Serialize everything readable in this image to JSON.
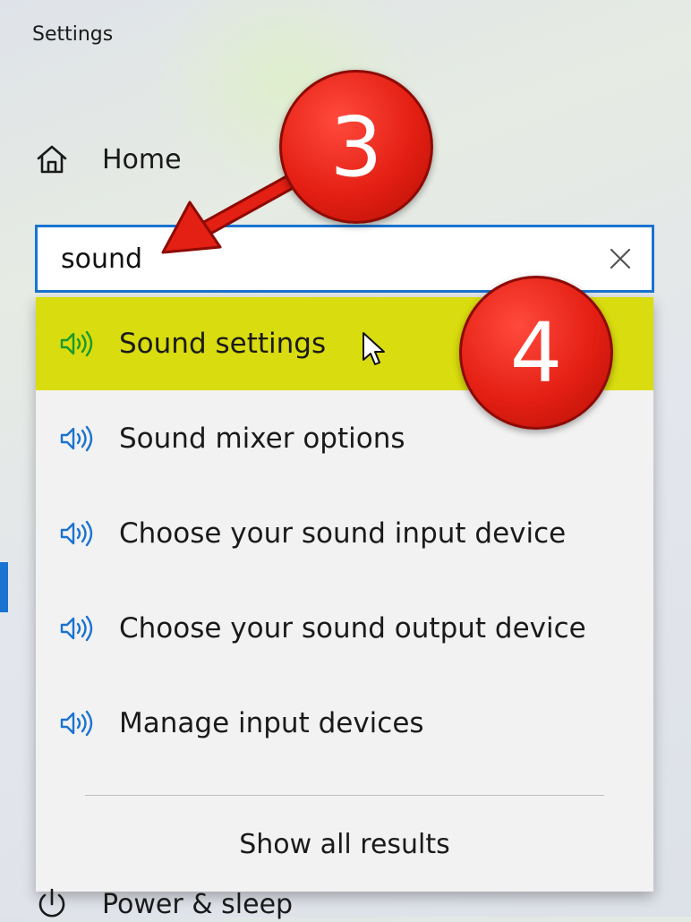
{
  "window": {
    "title": "Settings"
  },
  "sidebar": {
    "home_label": "Home",
    "bottom_item_label": "Power & sleep"
  },
  "search": {
    "value": "sound",
    "clear_icon": "close-icon"
  },
  "results": [
    {
      "label": "Sound settings",
      "icon": "speaker-icon",
      "highlighted": true
    },
    {
      "label": "Sound mixer options",
      "icon": "speaker-icon",
      "highlighted": false
    },
    {
      "label": "Choose your sound input device",
      "icon": "speaker-icon",
      "highlighted": false
    },
    {
      "label": "Choose your sound output device",
      "icon": "speaker-icon",
      "highlighted": false
    },
    {
      "label": "Manage input devices",
      "icon": "speaker-icon",
      "highlighted": false
    }
  ],
  "show_all_label": "Show all results",
  "annotations": {
    "step_a": "3",
    "step_b": "4"
  },
  "colors": {
    "accent": "#1a73d1",
    "highlight": "#d9dc0e",
    "speaker_highlight": "#1a9a2a",
    "speaker": "#1a73d1",
    "badge": "#e41f13"
  }
}
